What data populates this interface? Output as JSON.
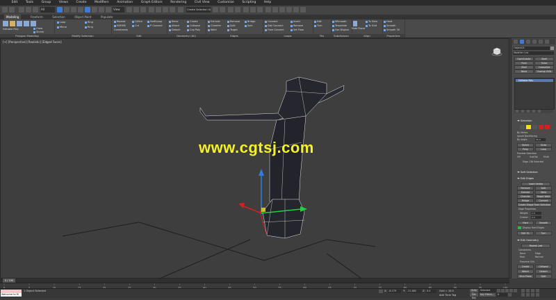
{
  "menubar": {
    "items": [
      "",
      "Edit",
      "Tools",
      "Group",
      "Views",
      "Create",
      "Modifiers",
      "Animation",
      "Graph Editors",
      "Rendering",
      "Civil View",
      "Customize",
      "Scripting",
      "Help"
    ]
  },
  "maintoolbar": {
    "selection_filter": "All",
    "view_dropdown": "View",
    "selection_set": "Create Selection Se"
  },
  "ribbon_tabs": [
    "Modeling",
    "Freeform",
    "Selection",
    "Object Paint",
    "Populate"
  ],
  "ribbon": {
    "groups": [
      {
        "title": "Polygon Modeling",
        "buttons": [
          "Editable Poly",
          "Grow",
          "Shrink",
          "Loop",
          "Ring"
        ]
      },
      {
        "title": "Modify Selection",
        "buttons": [
          "Mirror",
          "Ring"
        ]
      },
      {
        "title": "Edit",
        "buttons": [
          "Repeat",
          "NURMS",
          "Constraints",
          "QSlice",
          "Cut",
          "SwiftLoop",
          "P Connect"
        ]
      },
      {
        "title": "Geometry (All)",
        "buttons": [
          "Relax",
          "Attach",
          "Detach",
          "Create",
          "Collapse",
          "Cap Poly"
        ]
      },
      {
        "title": "Edges",
        "buttons": [
          "Extrude",
          "Chamfer",
          "Weld",
          "Remove",
          "Split",
          "Target",
          "Bridge",
          "Spin"
        ]
      },
      {
        "title": "Loops",
        "buttons": [
          "Connect",
          "Dist Connect",
          "Flow Connect",
          "Insert",
          "Remove",
          "Set Flow"
        ]
      },
      {
        "title": "Tris",
        "buttons": [
          "Edit",
          "Turn"
        ]
      },
      {
        "title": "Subdivision",
        "buttons": [
          "MSmooth",
          "Tessellate",
          "Use Displac"
        ]
      },
      {
        "title": "Align",
        "buttons": [
          "Make Planar",
          "To View",
          "To Grid"
        ]
      },
      {
        "title": "Properties",
        "buttons": [
          "Hard",
          "Smooth",
          "Smooth 30"
        ]
      }
    ]
  },
  "viewport": {
    "label": "[+] [Perspective] [Realistic] [Edged Faces]",
    "watermark": "www.cgtsj.com",
    "viewcube_icon": "viewcube-icon"
  },
  "command_panel": {
    "object_name": "Object01",
    "modifier_list": "Modifier List",
    "modifier_buttons": [
      "OpenSubdiv",
      "Shell",
      "Push",
      "Turbo",
      "Shell",
      "CreaseSet",
      "Bend",
      "Unwrap UVW"
    ],
    "stack_item": "Editable Poly",
    "selection": {
      "header": "Selection",
      "by_vertex": "By Vertex",
      "ignore_backfacing": "Ignore Backfacing",
      "by_angle": "By Angle:",
      "angle_value": "45.0",
      "shrink": "Shrink",
      "grow": "Grow",
      "ring": "Ring",
      "loop": "Loop",
      "preview_selection": "Preview Selection",
      "off": "Off",
      "subobj": "SubObj",
      "multi": "Multi",
      "edges_selected": "Edge 136 Selected"
    },
    "soft_selection": "Soft Selection",
    "edit_edges": {
      "header": "Edit Edges",
      "insert_vertex": "Insert Vertex",
      "remove": "Remove",
      "split": "Split",
      "extrude": "Extrude",
      "weld": "Weld",
      "chamfer": "Chamfer",
      "target_weld": "Target Weld",
      "bridge": "Bridge",
      "connect": "Connect",
      "create_shape": "Create Shape From Selection",
      "edge_properties": "Edge Properties",
      "weight": "Weight:",
      "weight_val": "1.0",
      "crease": "Crease:",
      "crease_val": "0.0",
      "hard": "Hard",
      "smooth": "Smooth",
      "display_hard": "Display Hard Edges",
      "edit_tri": "Edit Tri.",
      "turn": "Turn"
    },
    "edit_geometry": {
      "header": "Edit Geometry",
      "repeat_last": "Repeat Last",
      "constraints": "Constraints",
      "none": "None",
      "edge": "Edge",
      "face": "Face",
      "normal": "Normal",
      "preserve_uvs": "Preserve UVs",
      "create": "Create",
      "collapse": "Collapse",
      "attach": "Attach",
      "detach": "Detach",
      "slice_plane": "Slice Plane",
      "split": "Split"
    }
  },
  "timeline": {
    "frame_label": "0 / 100",
    "ticks": [
      "0",
      "5",
      "10",
      "15",
      "20",
      "25",
      "30",
      "35",
      "40",
      "45",
      "50",
      "55",
      "60",
      "65",
      "70",
      "75",
      "80",
      "85",
      "90",
      "95",
      "100"
    ]
  },
  "statusbar": {
    "maxscript_line1": "",
    "maxscript_line2": "Welcome to M",
    "selected": "1 Object Selected",
    "x_label": "X:",
    "x_val": "-6.179",
    "y_label": "Y:",
    "y_val": "-21.662",
    "z_label": "Z:",
    "z_val": "0.0",
    "grid": "Grid = 10.0",
    "add_time_tag": "Add Time Tag",
    "auto_key": "Auto Key",
    "selected_dropdown": "Selected",
    "set_key": "Set Key",
    "key_filters": "Key Filters...",
    "frame": "0"
  },
  "colors": {
    "watermark": "#f3f12a",
    "accent_blue": "#3d7bd6",
    "selection_yellow": "#f0e020",
    "selection_red": "#d42020"
  }
}
